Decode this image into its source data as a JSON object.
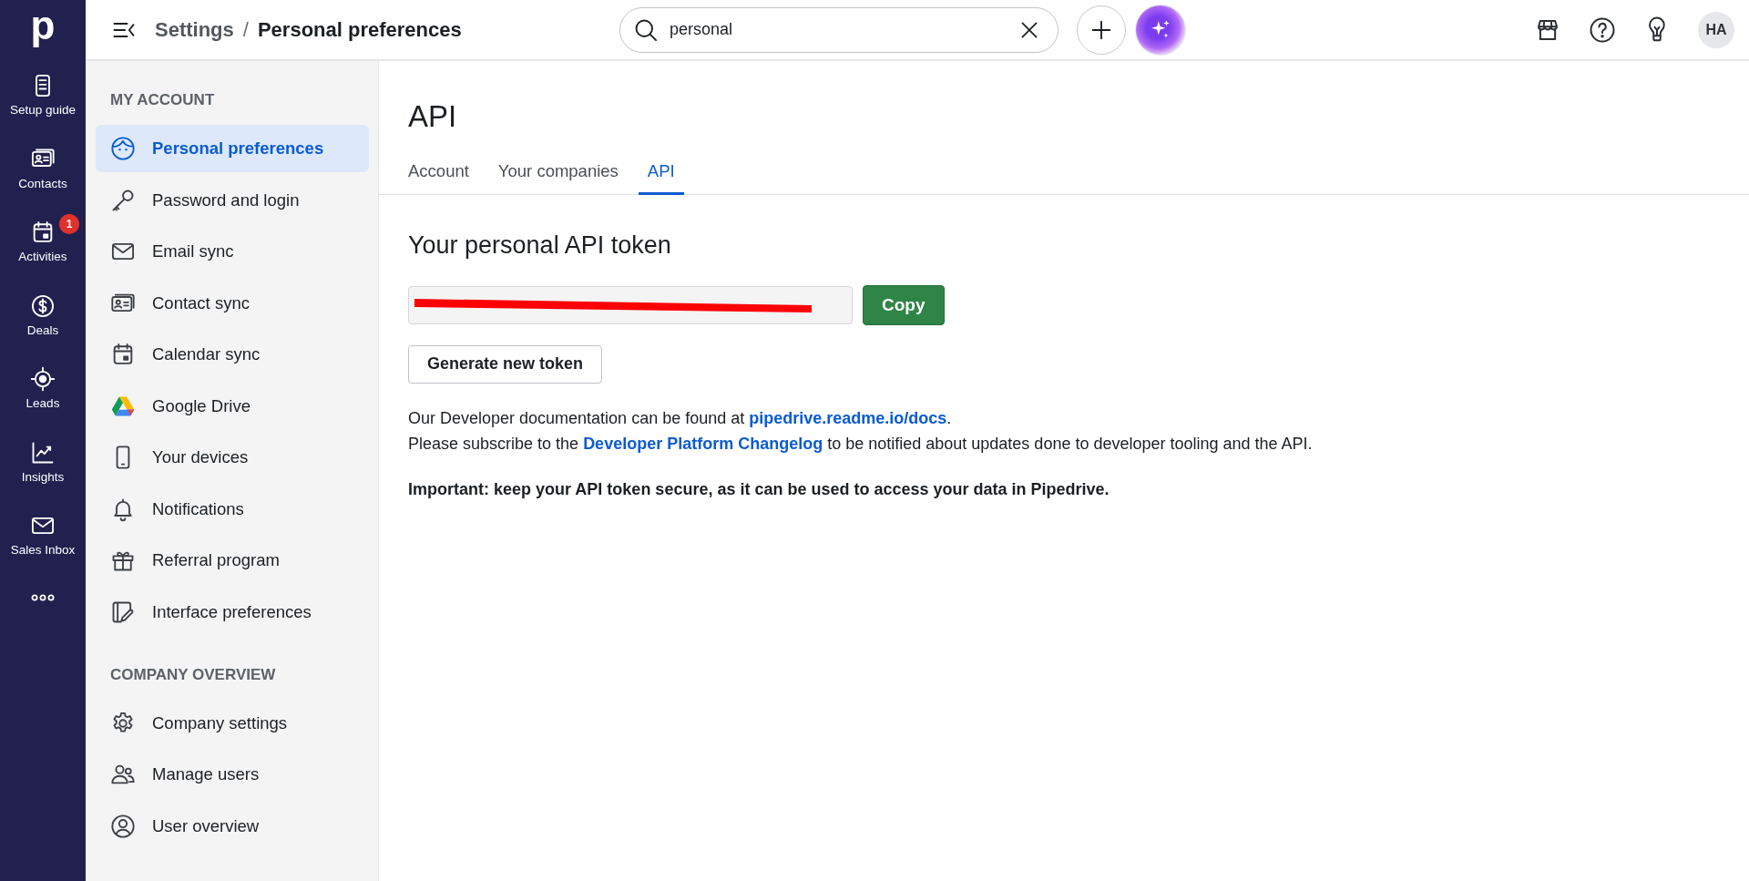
{
  "rail": {
    "logo": "p",
    "items": [
      {
        "label": "Setup guide"
      },
      {
        "label": "Contacts"
      },
      {
        "label": "Activities",
        "badge": "1"
      },
      {
        "label": "Deals"
      },
      {
        "label": "Leads"
      },
      {
        "label": "Insights"
      },
      {
        "label": "Sales Inbox"
      }
    ]
  },
  "topbar": {
    "breadcrumb": {
      "parent": "Settings",
      "separator": "/",
      "current": "Personal preferences"
    },
    "search": {
      "value": "personal"
    },
    "avatar": "HA"
  },
  "sidebar": {
    "sections": [
      {
        "title": "MY ACCOUNT",
        "items": [
          {
            "label": "Personal preferences",
            "selected": true
          },
          {
            "label": "Password and login",
            "selected": false
          },
          {
            "label": "Email sync",
            "selected": false
          },
          {
            "label": "Contact sync",
            "selected": false
          },
          {
            "label": "Calendar sync",
            "selected": false
          },
          {
            "label": "Google Drive",
            "selected": false
          },
          {
            "label": "Your devices",
            "selected": false
          },
          {
            "label": "Notifications",
            "selected": false
          },
          {
            "label": "Referral program",
            "selected": false
          },
          {
            "label": "Interface preferences",
            "selected": false
          }
        ]
      },
      {
        "title": "COMPANY OVERVIEW",
        "items": [
          {
            "label": "Company settings",
            "selected": false
          },
          {
            "label": "Manage users",
            "selected": false
          },
          {
            "label": "User overview",
            "selected": false
          }
        ]
      }
    ]
  },
  "page": {
    "title": "API",
    "tabs": [
      {
        "label": "Account",
        "selected": false
      },
      {
        "label": "Your companies",
        "selected": false
      },
      {
        "label": "API",
        "selected": true
      }
    ],
    "token": {
      "heading": "Your personal API token",
      "redacted": true,
      "copy_button": "Copy",
      "generate_button": "Generate new token"
    },
    "docs_line": {
      "before": "Our Developer documentation can be found at ",
      "link": "pipedrive.readme.io/docs",
      "after": "."
    },
    "changelog_line": {
      "before": "Please subscribe to the ",
      "link": "Developer Platform Changelog",
      "after": " to be notified about updates done to developer tooling and the API."
    },
    "warning": "Important: keep your API token secure, as it can be used to access your data in Pipedrive."
  }
}
